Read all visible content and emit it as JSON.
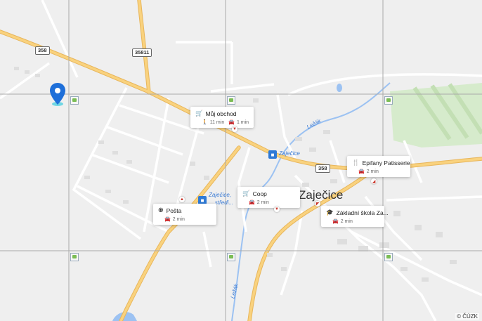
{
  "copyright": "© ČÚZK",
  "town_label": "Zaječice",
  "road_shields": [
    "358",
    "35811",
    "358"
  ],
  "stream_labels": [
    "Ležák",
    "Ležák"
  ],
  "bus_stop_labels": [
    "Zaječice",
    "Zaječice, ... středi..."
  ],
  "colors": {
    "map_background": "#efefef",
    "major_road": "#f7c86b",
    "minor_road": "#ffffff",
    "water": "#9cc2f2",
    "grid_line": "#aaaaaa",
    "field": "#cfe6c4",
    "location_marker": "#1e6fd9",
    "poi_arrow": "#c8352b"
  },
  "pois": [
    {
      "name": "Můj obchod",
      "icon": "cart-icon",
      "walk": "11 min",
      "drive": "1 min"
    },
    {
      "name": "Coop",
      "icon": "cart-icon",
      "drive": "2 min"
    },
    {
      "name": "Epifany Patisserie",
      "icon": "restaurant-icon",
      "drive": "2 min"
    },
    {
      "name": "Pošta",
      "icon": "post-office-icon",
      "drive": "2 min"
    },
    {
      "name": "Základní škola Za...",
      "icon": "school-icon",
      "drive": "2 min"
    }
  ]
}
